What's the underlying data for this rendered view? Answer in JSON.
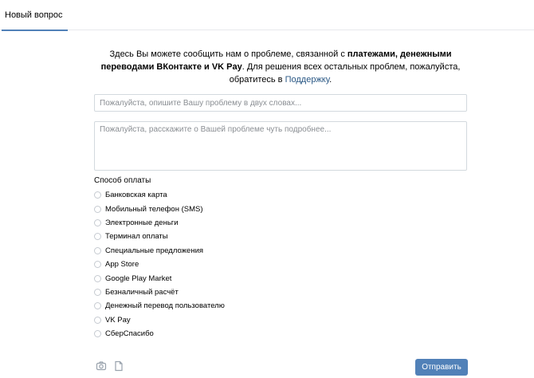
{
  "tabs": [
    {
      "label": "Новый вопрос",
      "active": true
    }
  ],
  "intro": {
    "part1": "Здесь Вы можете сообщить нам о проблеме, связанной с ",
    "bold1": "платежами, денежными переводами ВКонтакте и VK Pay",
    "part2": ". Для решения всех остальных проблем, пожалуйста, обратитесь в ",
    "link": "Поддержку",
    "part3": "."
  },
  "form": {
    "subject_placeholder": "Пожалуйста, опишите Вашу проблему в двух словах...",
    "details_placeholder": "Пожалуйста, расскажите о Вашей проблеме чуть подробнее...",
    "payment_label": "Способ оплаты",
    "payment_options": [
      "Банковская карта",
      "Мобильный телефон (SMS)",
      "Электронные деньги",
      "Терминал оплаты",
      "Специальные предложения",
      "App Store",
      "Google Play Market",
      "Безналичный расчёт",
      "Денежный перевод пользователю",
      "VK Pay",
      "СберСпасибо"
    ],
    "submit_label": "Отправить"
  },
  "colors": {
    "accent": "#5181b8",
    "link": "#2a5885",
    "border": "#d3d9de"
  },
  "icons": {
    "attach_photo": "camera-icon",
    "attach_document": "document-icon"
  }
}
